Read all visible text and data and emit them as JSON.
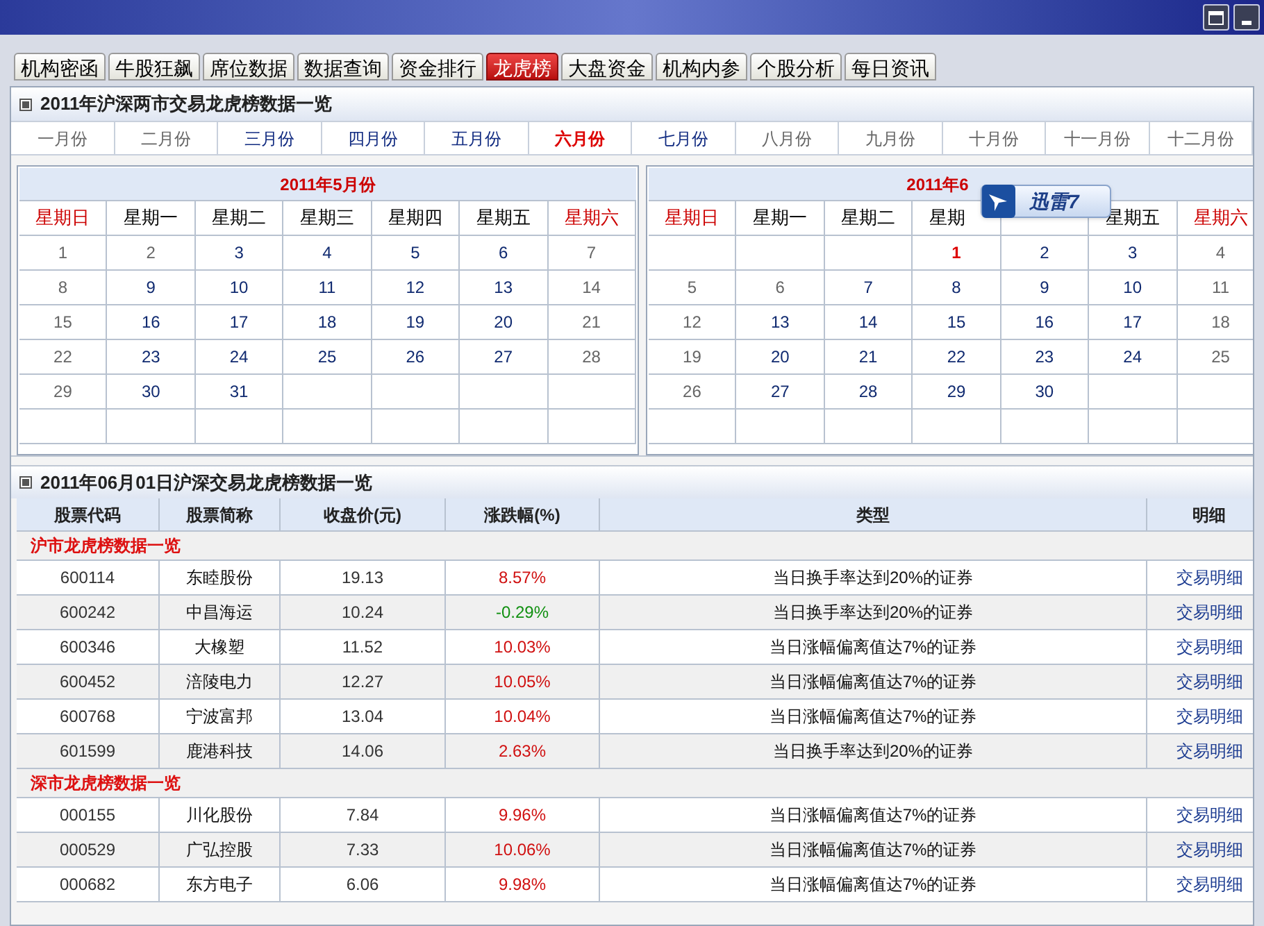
{
  "window": {
    "buttons": [
      {
        "kind": "maximize"
      },
      {
        "kind": "minimize"
      }
    ]
  },
  "tabs": [
    {
      "label": "机构密函",
      "selected": false
    },
    {
      "label": "牛股狂飙",
      "selected": false
    },
    {
      "label": "席位数据",
      "selected": false
    },
    {
      "label": "数据查询",
      "selected": false
    },
    {
      "label": "资金排行",
      "selected": false
    },
    {
      "label": "龙虎榜",
      "selected": true
    },
    {
      "label": "大盘资金",
      "selected": false
    },
    {
      "label": "机构内参",
      "selected": false
    },
    {
      "label": "个股分析",
      "selected": false
    },
    {
      "label": "每日资讯",
      "selected": false
    }
  ],
  "year_panel": {
    "title": "2011年沪深两市交易龙虎榜数据一览",
    "months": [
      {
        "label": "一月份",
        "available": false,
        "selected": false
      },
      {
        "label": "二月份",
        "available": false,
        "selected": false
      },
      {
        "label": "三月份",
        "available": true,
        "selected": false
      },
      {
        "label": "四月份",
        "available": true,
        "selected": false
      },
      {
        "label": "五月份",
        "available": true,
        "selected": false
      },
      {
        "label": "六月份",
        "selected": true
      },
      {
        "label": "七月份",
        "available": true,
        "selected": false
      },
      {
        "label": "八月份",
        "available": false,
        "selected": false
      },
      {
        "label": "九月份",
        "available": false,
        "selected": false
      },
      {
        "label": "十月份",
        "available": false,
        "selected": false
      },
      {
        "label": "十一月份",
        "available": false,
        "selected": false
      },
      {
        "label": "十二月份",
        "available": false,
        "selected": false
      }
    ],
    "calendars": [
      {
        "title": "2011年5月份",
        "weekdays": [
          {
            "label": "星期日",
            "weekend": true
          },
          {
            "label": "星期一",
            "weekend": false
          },
          {
            "label": "星期二",
            "weekend": false
          },
          {
            "label": "星期三",
            "weekend": false
          },
          {
            "label": "星期四",
            "weekend": false
          },
          {
            "label": "星期五",
            "weekend": false
          },
          {
            "label": "星期六",
            "weekend": true
          }
        ],
        "weeks": [
          [
            {
              "day": "1",
              "available": false,
              "selected": false
            },
            {
              "day": "2",
              "available": false,
              "selected": false
            },
            {
              "day": "3",
              "available": true,
              "selected": false
            },
            {
              "day": "4",
              "available": true,
              "selected": false
            },
            {
              "day": "5",
              "available": true,
              "selected": false
            },
            {
              "day": "6",
              "available": true,
              "selected": false
            },
            {
              "day": "7",
              "available": false,
              "selected": false
            }
          ],
          [
            {
              "day": "8",
              "available": false,
              "selected": false
            },
            {
              "day": "9",
              "available": true,
              "selected": false
            },
            {
              "day": "10",
              "available": true,
              "selected": false
            },
            {
              "day": "11",
              "available": true,
              "selected": false
            },
            {
              "day": "12",
              "available": true,
              "selected": false
            },
            {
              "day": "13",
              "available": true,
              "selected": false
            },
            {
              "day": "14",
              "available": false,
              "selected": false
            }
          ],
          [
            {
              "day": "15",
              "available": false,
              "selected": false
            },
            {
              "day": "16",
              "available": true,
              "selected": false
            },
            {
              "day": "17",
              "available": true,
              "selected": false
            },
            {
              "day": "18",
              "available": true,
              "selected": false
            },
            {
              "day": "19",
              "available": true,
              "selected": false
            },
            {
              "day": "20",
              "available": true,
              "selected": false
            },
            {
              "day": "21",
              "available": false,
              "selected": false
            }
          ],
          [
            {
              "day": "22",
              "available": false,
              "selected": false
            },
            {
              "day": "23",
              "available": true,
              "selected": false
            },
            {
              "day": "24",
              "available": true,
              "selected": false
            },
            {
              "day": "25",
              "available": true,
              "selected": false
            },
            {
              "day": "26",
              "available": true,
              "selected": false
            },
            {
              "day": "27",
              "available": true,
              "selected": false
            },
            {
              "day": "28",
              "available": false,
              "selected": false
            }
          ],
          [
            {
              "day": "29",
              "available": false,
              "selected": false
            },
            {
              "day": "30",
              "available": true,
              "selected": false
            },
            {
              "day": "31",
              "available": true,
              "selected": false
            },
            {
              "kind": "empty"
            },
            {
              "kind": "empty"
            },
            {
              "kind": "empty"
            },
            {
              "kind": "empty"
            }
          ],
          [
            {
              "kind": "empty"
            },
            {
              "kind": "empty"
            },
            {
              "kind": "empty"
            },
            {
              "kind": "empty"
            },
            {
              "kind": "empty"
            },
            {
              "kind": "empty"
            },
            {
              "kind": "empty"
            }
          ]
        ]
      },
      {
        "title": "2011年6",
        "weekdays": [
          {
            "label": "星期日",
            "weekend": true
          },
          {
            "label": "星期一",
            "weekend": false
          },
          {
            "label": "星期二",
            "weekend": false
          },
          {
            "label": "星期",
            "weekend": false
          },
          {
            "kind": "covered"
          },
          {
            "label": "星期五",
            "weekend": false
          },
          {
            "label": "星期六",
            "weekend": true
          }
        ],
        "weeks": [
          [
            {
              "kind": "empty"
            },
            {
              "kind": "empty"
            },
            {
              "kind": "empty"
            },
            {
              "day": "1",
              "available": true,
              "selected": true
            },
            {
              "day": "2",
              "available": true,
              "selected": false
            },
            {
              "day": "3",
              "available": true,
              "selected": false
            },
            {
              "day": "4",
              "available": false,
              "selected": false
            }
          ],
          [
            {
              "day": "5",
              "available": false,
              "selected": false
            },
            {
              "day": "6",
              "available": false,
              "selected": false
            },
            {
              "day": "7",
              "available": true,
              "selected": false
            },
            {
              "day": "8",
              "available": true,
              "selected": false
            },
            {
              "day": "9",
              "available": true,
              "selected": false
            },
            {
              "day": "10",
              "available": true,
              "selected": false
            },
            {
              "day": "11",
              "available": false,
              "selected": false
            }
          ],
          [
            {
              "day": "12",
              "available": false,
              "selected": false
            },
            {
              "day": "13",
              "available": true,
              "selected": false
            },
            {
              "day": "14",
              "available": true,
              "selected": false
            },
            {
              "day": "15",
              "available": true,
              "selected": false
            },
            {
              "day": "16",
              "available": true,
              "selected": false
            },
            {
              "day": "17",
              "available": true,
              "selected": false
            },
            {
              "day": "18",
              "available": false,
              "selected": false
            }
          ],
          [
            {
              "day": "19",
              "available": false,
              "selected": false
            },
            {
              "day": "20",
              "available": true,
              "selected": false
            },
            {
              "day": "21",
              "available": true,
              "selected": false
            },
            {
              "day": "22",
              "available": true,
              "selected": false
            },
            {
              "day": "23",
              "available": true,
              "selected": false
            },
            {
              "day": "24",
              "available": true,
              "selected": false
            },
            {
              "day": "25",
              "available": false,
              "selected": false
            }
          ],
          [
            {
              "day": "26",
              "available": false,
              "selected": false
            },
            {
              "day": "27",
              "available": true,
              "selected": false
            },
            {
              "day": "28",
              "available": true,
              "selected": false
            },
            {
              "day": "29",
              "available": true,
              "selected": false
            },
            {
              "day": "30",
              "available": true,
              "selected": false
            },
            {
              "kind": "empty"
            },
            {
              "kind": "empty"
            }
          ],
          [
            {
              "kind": "empty"
            },
            {
              "kind": "empty"
            },
            {
              "kind": "empty"
            },
            {
              "kind": "empty"
            },
            {
              "kind": "empty"
            },
            {
              "kind": "empty"
            },
            {
              "kind": "empty"
            }
          ]
        ]
      }
    ]
  },
  "floating_widget": {
    "label": "迅雷7"
  },
  "day_panel": {
    "title": "2011年06月01日沪深交易龙虎榜数据一览",
    "columns": [
      "股票代码",
      "股票简称",
      "收盘价(元)",
      "涨跌幅(%)",
      "类型",
      "明细"
    ],
    "groups": [
      {
        "title": "沪市龙虎榜数据一览",
        "rows": [
          {
            "code": "600114",
            "name": "东睦股份",
            "close": "19.13",
            "change": "8.57%",
            "rising": true,
            "type": "当日换手率达到20%的证券",
            "link": "交易明细"
          },
          {
            "code": "600242",
            "name": "中昌海运",
            "close": "10.24",
            "change": "-0.29%",
            "rising": false,
            "type": "当日换手率达到20%的证券",
            "link": "交易明细"
          },
          {
            "code": "600346",
            "name": "大橡塑",
            "close": "11.52",
            "change": "10.03%",
            "rising": true,
            "type": "当日涨幅偏离值达7%的证券",
            "link": "交易明细"
          },
          {
            "code": "600452",
            "name": "涪陵电力",
            "close": "12.27",
            "change": "10.05%",
            "rising": true,
            "type": "当日涨幅偏离值达7%的证券",
            "link": "交易明细"
          },
          {
            "code": "600768",
            "name": "宁波富邦",
            "close": "13.04",
            "change": "10.04%",
            "rising": true,
            "type": "当日涨幅偏离值达7%的证券",
            "link": "交易明细"
          },
          {
            "code": "601599",
            "name": "鹿港科技",
            "close": "14.06",
            "change": "2.63%",
            "rising": true,
            "type": "当日换手率达到20%的证券",
            "link": "交易明细"
          }
        ]
      },
      {
        "title": "深市龙虎榜数据一览",
        "rows": [
          {
            "code": "000155",
            "name": "川化股份",
            "close": "7.84",
            "change": "9.96%",
            "rising": true,
            "type": "当日涨幅偏离值达7%的证券",
            "link": "交易明细"
          },
          {
            "code": "000529",
            "name": "广弘控股",
            "close": "7.33",
            "change": "10.06%",
            "rising": true,
            "type": "当日涨幅偏离值达7%的证券",
            "link": "交易明细"
          },
          {
            "code": "000682",
            "name": "东方电子",
            "close": "6.06",
            "change": "9.98%",
            "rising": true,
            "type": "当日涨幅偏离值达7%的证券",
            "link": "交易明细"
          }
        ]
      }
    ]
  }
}
